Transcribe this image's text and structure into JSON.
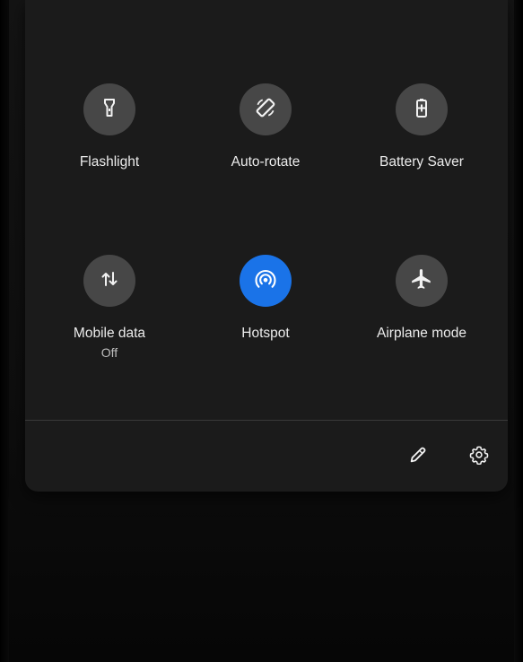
{
  "quick_settings": {
    "tiles": [
      {
        "label": "Flashlight",
        "icon": "flashlight-icon",
        "active": false
      },
      {
        "label": "Auto-rotate",
        "icon": "auto-rotate-icon",
        "active": false
      },
      {
        "label": "Battery Saver",
        "icon": "battery-saver-icon",
        "active": false
      },
      {
        "label": "Mobile data",
        "sublabel": "Off",
        "icon": "mobile-data-icon",
        "active": false
      },
      {
        "label": "Hotspot",
        "icon": "hotspot-icon",
        "active": true
      },
      {
        "label": "Airplane mode",
        "icon": "airplane-icon",
        "active": false
      }
    ],
    "footer": {
      "edit_icon": "pencil-icon",
      "settings_icon": "gear-icon"
    }
  },
  "colors": {
    "panel_bg": "#1b1b1b",
    "tile_inactive": "#474747",
    "tile_active": "#1a73e8",
    "text_primary": "#ececec",
    "text_secondary": "#bdbdbd"
  }
}
